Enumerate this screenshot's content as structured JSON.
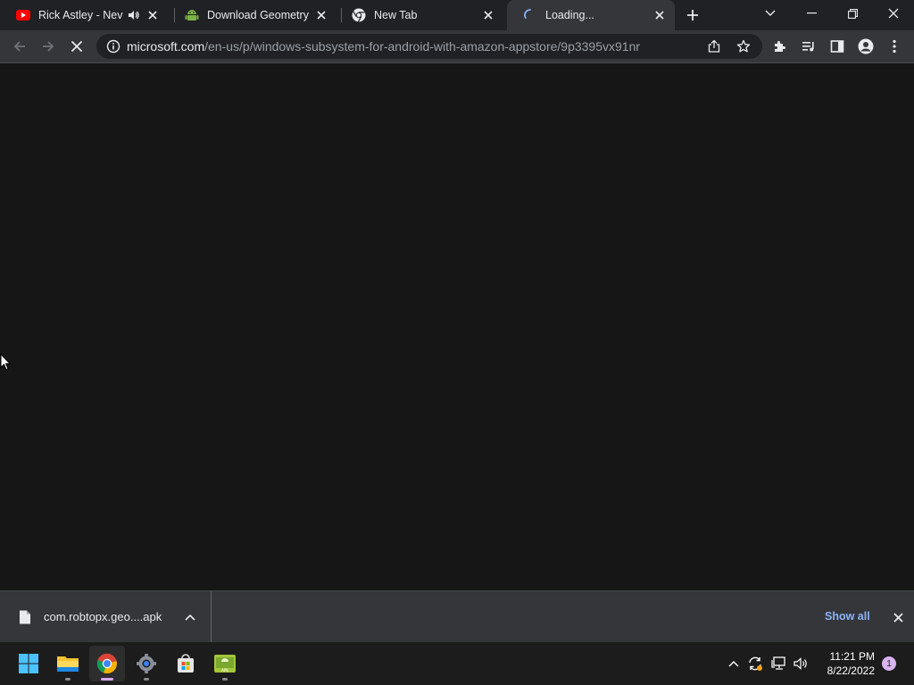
{
  "tabs": [
    {
      "title": "Rick Astley - Never",
      "favicon": "youtube-icon",
      "audio": "speaker-icon"
    },
    {
      "title": "Download Geometry D",
      "favicon": "android-icon"
    },
    {
      "title": "New Tab",
      "favicon": "chrome-icon"
    },
    {
      "title": "Loading...",
      "favicon": "loading-spinner-icon",
      "active": true
    }
  ],
  "address_bar": {
    "domain": "microsoft.com",
    "path": "/en-us/p/windows-subsystem-for-android-with-amazon-appstore/9p3395vx91nr"
  },
  "download_shelf": {
    "filename": "com.robtopx.geo....apk",
    "show_all_label": "Show all"
  },
  "taskbar": {
    "apps": [
      "start-icon",
      "file-explorer-icon",
      "chrome-icon",
      "settings-icon",
      "microsoft-store-icon",
      "apk-installer-icon"
    ],
    "active_app": "chrome-icon",
    "time": "11:21 PM",
    "date": "8/22/2022",
    "notification_count": "1"
  },
  "colors": {
    "accent_link": "#8ab4f8",
    "tabstrip": "#202124",
    "toolbar": "#35363a",
    "page_background": "#161616"
  }
}
